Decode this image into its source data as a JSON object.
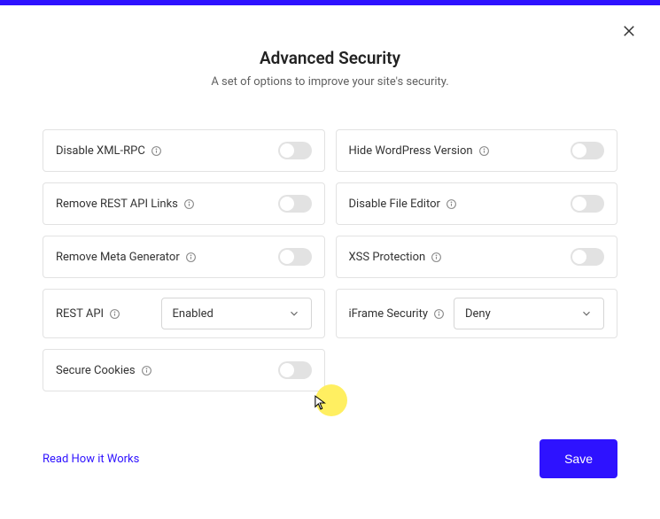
{
  "header": {
    "title": "Advanced Security",
    "subtitle": "A set of options to improve your site's security."
  },
  "options": {
    "disable_xmlrpc": "Disable XML-RPC",
    "hide_wp_version": "Hide WordPress Version",
    "remove_rest_links": "Remove REST API Links",
    "disable_file_editor": "Disable File Editor",
    "remove_meta_generator": "Remove Meta Generator",
    "xss_protection": "XSS Protection",
    "rest_api": "REST API",
    "rest_api_value": "Enabled",
    "iframe_security": "iFrame Security",
    "iframe_security_value": "Deny",
    "secure_cookies": "Secure Cookies"
  },
  "footer": {
    "help_link": "Read How it Works",
    "save_label": "Save"
  }
}
